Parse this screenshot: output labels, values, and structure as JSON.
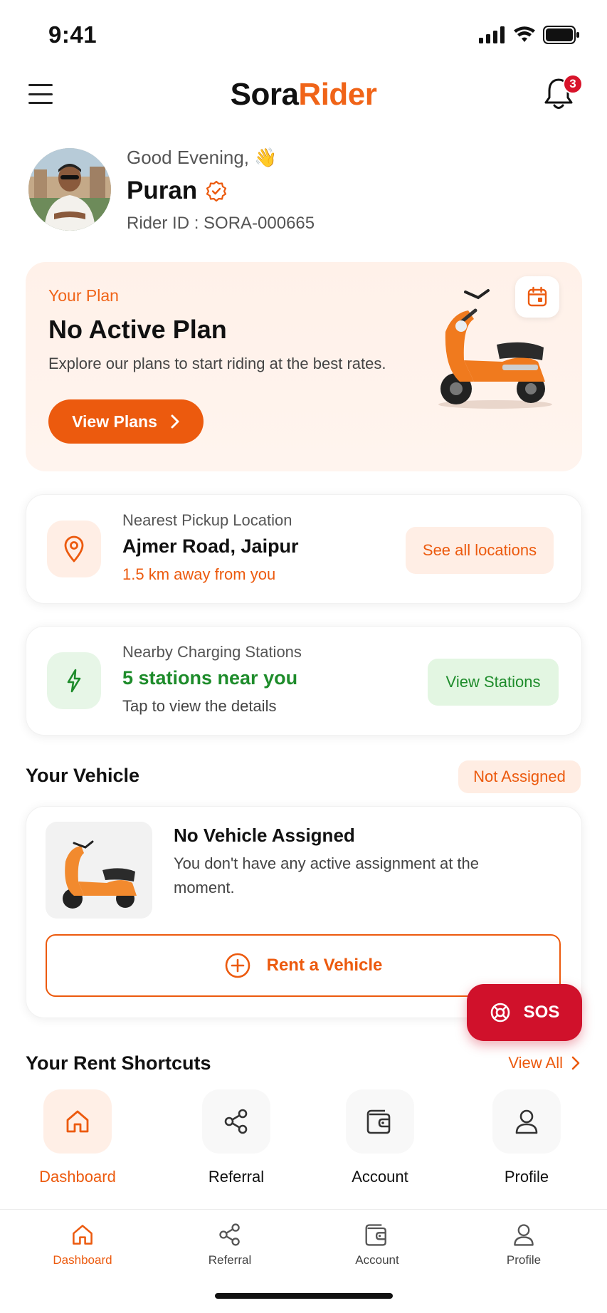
{
  "status_bar": {
    "time": "9:41"
  },
  "header": {
    "brand_part1": "Sora",
    "brand_part2": "Rider",
    "notification_count": "3"
  },
  "greeting": {
    "salutation": "Good Evening,",
    "wave_emoji": "👋",
    "name": "Puran",
    "rider_id": "Rider ID : SORA-000665"
  },
  "plan": {
    "label": "Your Plan",
    "title": "No Active Plan",
    "description": "Explore our plans to start riding at the best rates.",
    "button_label": "View Plans"
  },
  "pickup": {
    "subtitle": "Nearest Pickup Location",
    "location": "Ajmer Road, Jaipur",
    "distance": "1.5 km away from you",
    "button_label": "See all locations"
  },
  "charging": {
    "subtitle": "Nearby Charging Stations",
    "count_text": "5 stations near you",
    "hint": "Tap to view the details",
    "button_label": "View Stations"
  },
  "vehicle": {
    "section_title": "Your Vehicle",
    "status": "Not Assigned",
    "title": "No Vehicle Assigned",
    "description": "You don't have any active assignment at the moment.",
    "rent_button": "Rent a Vehicle"
  },
  "sos": {
    "label": "SOS"
  },
  "shortcuts": {
    "section_title": "Your Rent Shortcuts",
    "view_all": "View All",
    "items": [
      {
        "label": "Dashboard",
        "icon": "home-icon"
      },
      {
        "label": "Referral",
        "icon": "share-icon"
      },
      {
        "label": "Account",
        "icon": "wallet-icon"
      },
      {
        "label": "Profile",
        "icon": "user-icon"
      }
    ]
  },
  "bottom_nav": {
    "items": [
      {
        "label": "Dashboard",
        "icon": "home-icon"
      },
      {
        "label": "Referral",
        "icon": "share-icon"
      },
      {
        "label": "Account",
        "icon": "wallet-icon"
      },
      {
        "label": "Profile",
        "icon": "user-icon"
      }
    ]
  },
  "colors": {
    "accent": "#EC5A0E",
    "green": "#1E8C2B",
    "sos": "#D0112B"
  }
}
